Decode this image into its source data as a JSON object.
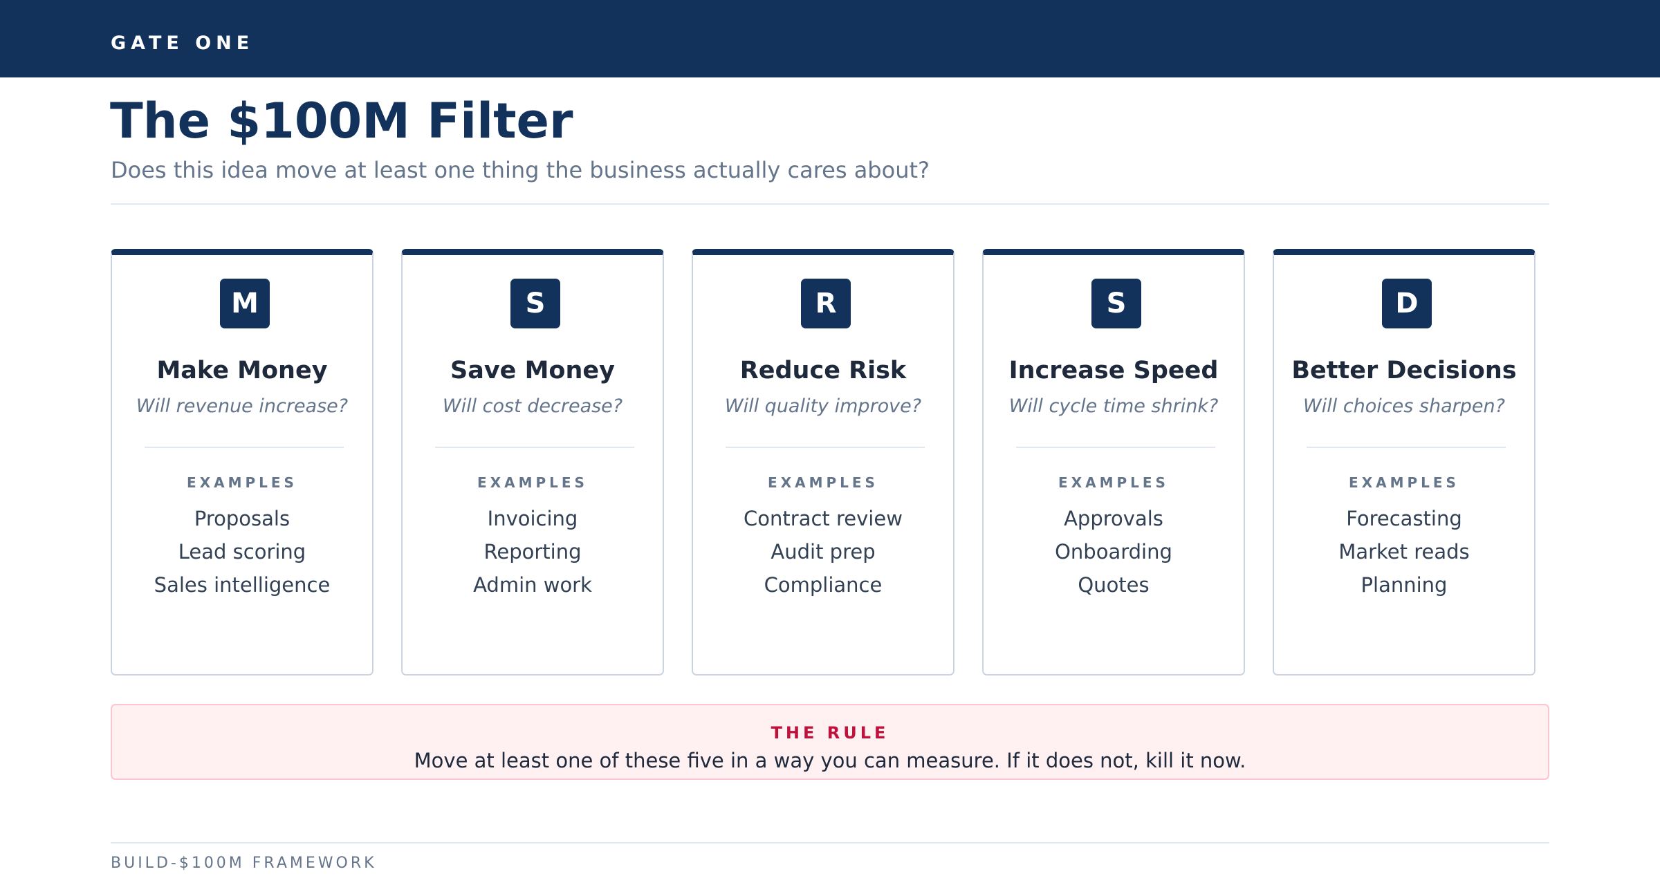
{
  "header": {
    "brand": "GATE ONE"
  },
  "page": {
    "title": "The $100M Filter",
    "subtitle": "Does this idea move at least one thing the business actually cares about?"
  },
  "cards": [
    {
      "letter": "M",
      "title": "Make Money",
      "question": "Will revenue increase?",
      "examples_label": "EXAMPLES",
      "examples": [
        "Proposals",
        "Lead scoring",
        "Sales intelligence"
      ]
    },
    {
      "letter": "S",
      "title": "Save Money",
      "question": "Will cost decrease?",
      "examples_label": "EXAMPLES",
      "examples": [
        "Invoicing",
        "Reporting",
        "Admin work"
      ]
    },
    {
      "letter": "R",
      "title": "Reduce Risk",
      "question": "Will quality improve?",
      "examples_label": "EXAMPLES",
      "examples": [
        "Contract review",
        "Audit prep",
        "Compliance"
      ]
    },
    {
      "letter": "S",
      "title": "Increase Speed",
      "question": "Will cycle time shrink?",
      "examples_label": "EXAMPLES",
      "examples": [
        "Approvals",
        "Onboarding",
        "Quotes"
      ]
    },
    {
      "letter": "D",
      "title": "Better Decisions",
      "question": "Will choices sharpen?",
      "examples_label": "EXAMPLES",
      "examples": [
        "Forecasting",
        "Market reads",
        "Planning"
      ]
    }
  ],
  "rule": {
    "label": "THE RULE",
    "text": "Move at least one of these five in a way you can measure. If it does not, kill it now."
  },
  "footer": {
    "text": "BUILD-$100M FRAMEWORK"
  },
  "colors": {
    "navy": "#12325b",
    "rule_accent": "#be123c",
    "rule_background": "#fff0f2"
  }
}
